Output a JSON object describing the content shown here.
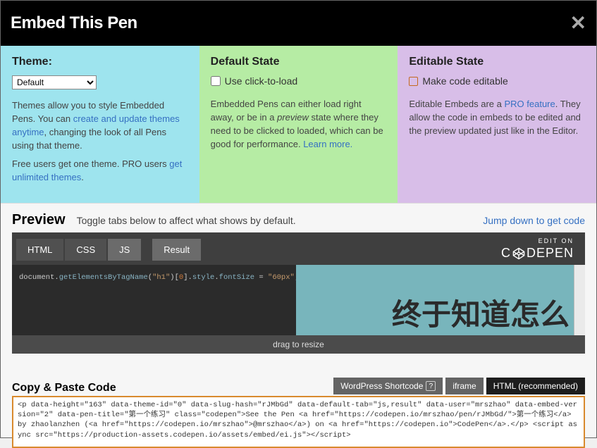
{
  "header": {
    "title": "Embed This Pen",
    "close": "✕"
  },
  "theme": {
    "heading": "Theme:",
    "select_value": "Default",
    "para1_a": "Themes allow you to style Embedded Pens. You can ",
    "para1_link": "create and update themes anytime",
    "para1_b": ", changing the look of all Pens using that theme.",
    "para2_a": "Free users get one theme. PRO users ",
    "para2_link": "get unlimited themes",
    "para2_b": "."
  },
  "default_state": {
    "heading": "Default State",
    "checkbox_label": "Use click-to-load",
    "para_a": "Embedded Pens can either load right away, or be in a ",
    "para_i": "preview",
    "para_b": " state where they need to be clicked to loaded, which can be good for performance. ",
    "para_link": "Learn more.",
    "para_c": ""
  },
  "editable_state": {
    "heading": "Editable State",
    "checkbox_label": "Make code editable",
    "para_a": "Editable Embeds are a ",
    "para_link": "PRO feature",
    "para_b": ". They allow the code in embeds to be edited and the preview updated just like in the Editor."
  },
  "preview": {
    "heading": "Preview",
    "subtitle": "Toggle tabs below to affect what shows by default.",
    "jump": "Jump down to get code",
    "tabs": {
      "html": "HTML",
      "css": "CSS",
      "js": "JS",
      "result": "Result"
    },
    "edit_on": "EDIT ON",
    "logo": "C   DEPEN",
    "code_line": "document.getElementsByTagName(\"h1\")[0].style.fontSize = \"60px\";",
    "result_text": "终于知道怎么",
    "drag": "drag to resize"
  },
  "copy": {
    "heading": "Copy & Paste Code",
    "tabs": {
      "wp": "WordPress Shortcode",
      "iframe": "iframe",
      "html": "HTML (recommended)"
    },
    "code": "<p data-height=\"163\" data-theme-id=\"0\" data-slug-hash=\"rJMbGd\" data-default-tab=\"js,result\" data-user=\"mrszhao\" data-embed-version=\"2\" data-pen-title=\"第一个练习\" class=\"codepen\">See the Pen <a href=\"https://codepen.io/mrszhao/pen/rJMbGd/\">第一个练习</a> by zhaolanzhen (<a href=\"https://codepen.io/mrszhao\">@mrszhao</a>) on <a href=\"https://codepen.io\">CodePen</a>.</p>\n<script async src=\"https://production-assets.codepen.io/assets/embed/ei.js\"></script>"
  }
}
